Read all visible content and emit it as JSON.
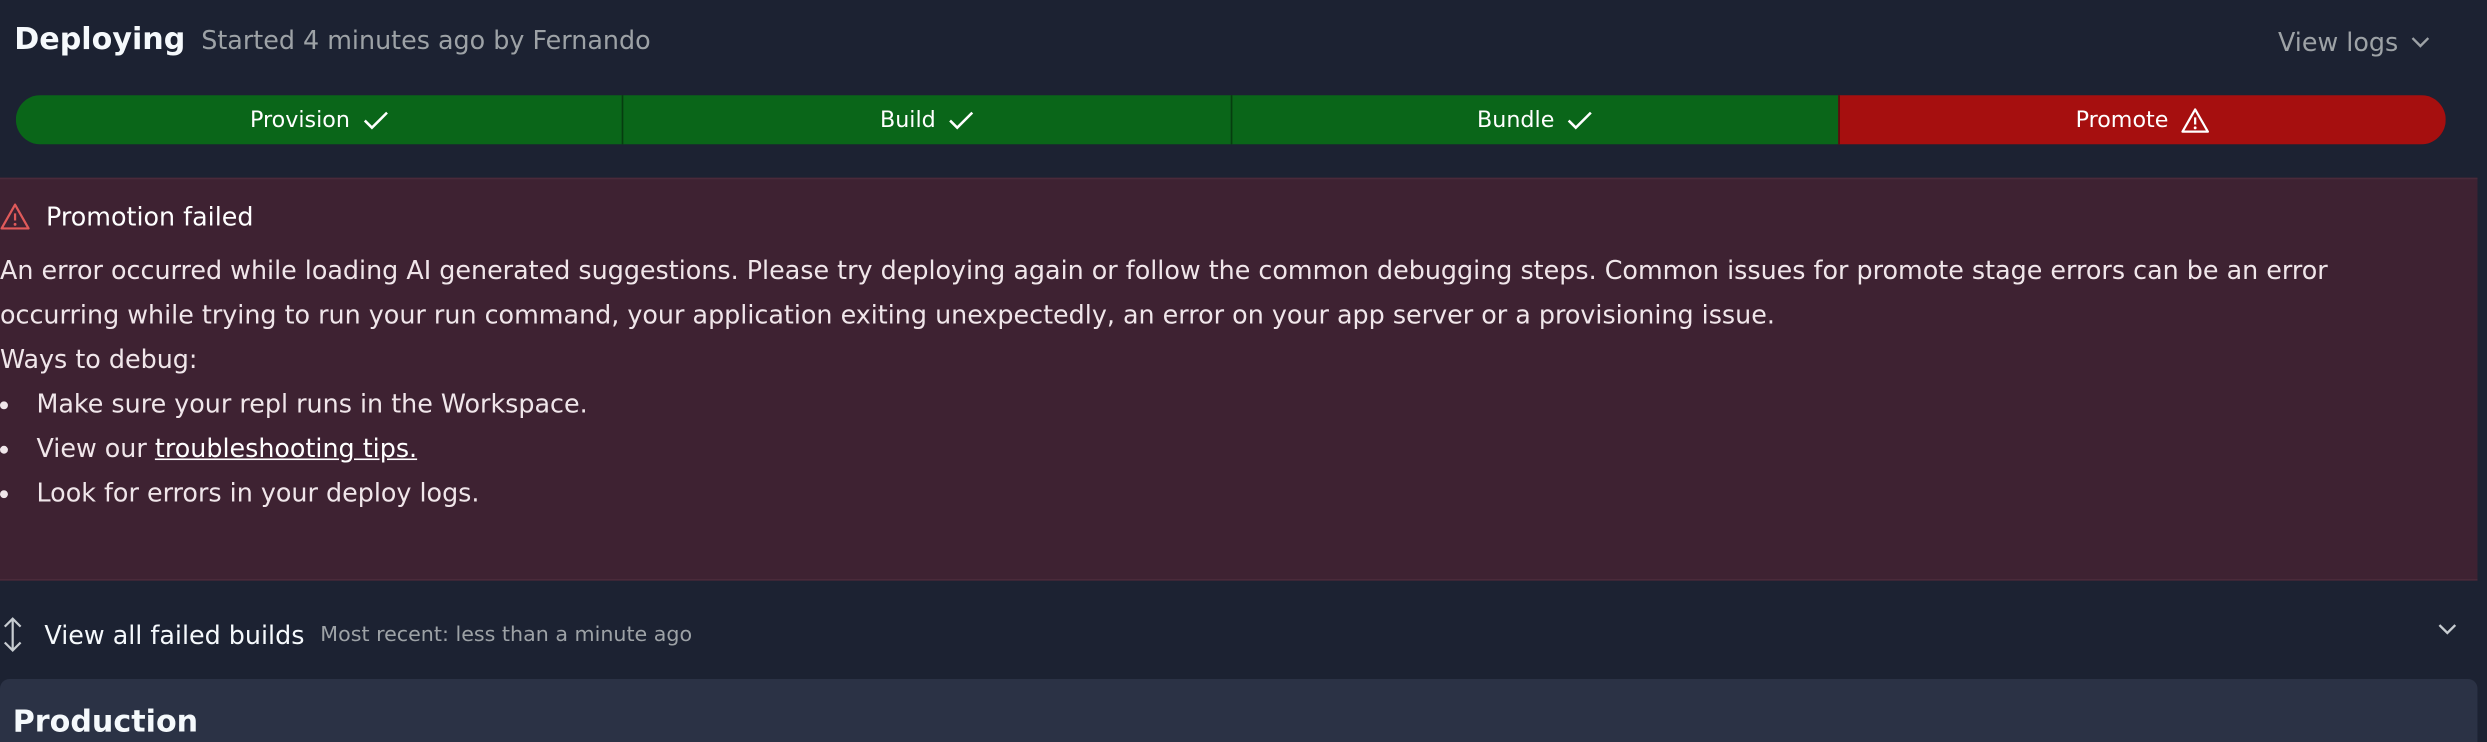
{
  "header": {
    "title": "Deploying",
    "subtitle": "Started 4 minutes ago by Fernando",
    "view_logs_label": "View logs"
  },
  "steps": [
    {
      "label": "Provision",
      "status": "success",
      "icon": "check-icon"
    },
    {
      "label": "Build",
      "status": "success",
      "icon": "check-icon"
    },
    {
      "label": "Bundle",
      "status": "success",
      "icon": "check-icon"
    },
    {
      "label": "Promote",
      "status": "failed",
      "icon": "warning-icon"
    }
  ],
  "colors": {
    "success": "#0a6619",
    "failed": "#a60f0f",
    "error_panel_bg": "#3e2232",
    "page_bg": "#1c2232"
  },
  "error": {
    "title": "Promotion failed",
    "message": "An error occurred while loading AI generated suggestions. Please try deploying again or follow the common debugging steps. Common issues for promote stage errors can be an error occurring while trying to run your run command, your application exiting unexpectedly, an error on your app server or a provisioning issue.",
    "ways_heading": "Ways to debug:",
    "steps": {
      "item1": "Make sure your repl runs in the Workspace.",
      "item2_prefix": "View our ",
      "item2_link": "troubleshooting tips.",
      "item3": "Look for errors in your deploy logs."
    }
  },
  "failed_builds": {
    "label": "View all failed builds",
    "recent": "Most recent: less than a minute ago"
  },
  "production": {
    "title": "Production"
  }
}
